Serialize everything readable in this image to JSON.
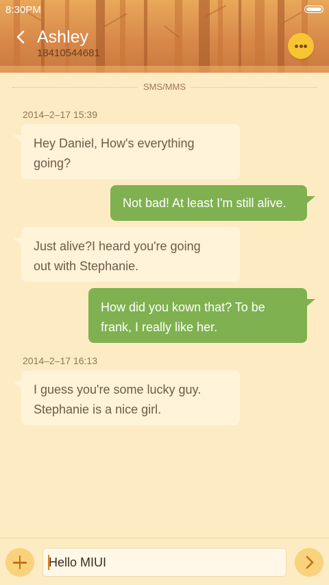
{
  "status_bar": {
    "time": "8:30PM"
  },
  "header": {
    "contact_name": "Ashley",
    "contact_number": "18410544681"
  },
  "icons": {
    "back": "chevron-left-icon",
    "more": "more-dots-icon",
    "add": "plus-icon",
    "send": "chevron-right-icon",
    "battery": "battery-icon"
  },
  "conversation": {
    "channel_label": "SMS/MMS",
    "timestamps": [
      "2014–2–17 15:39",
      "2014–2–17 16:13"
    ],
    "messages": [
      {
        "direction": "incoming",
        "text_lines": [
          "Hey Daniel, How's everything",
          "going?"
        ]
      },
      {
        "direction": "outgoing",
        "text_lines": [
          "Not bad! At least I'm still alive."
        ]
      },
      {
        "direction": "incoming",
        "text_lines": [
          "Just  alive?I heard you're going",
          "out with Stephanie."
        ]
      },
      {
        "direction": "outgoing",
        "text_lines": [
          "How did you kown that? To be",
          "frank, I really like her."
        ]
      },
      {
        "direction": "incoming",
        "text_lines": [
          "I guess you're some lucky guy.",
          "Stephanie is a nice girl."
        ]
      }
    ]
  },
  "composer": {
    "input_value": "Hello MIUI"
  },
  "colors": {
    "background": "#fdebc4",
    "incoming_bubble": "#fff3d9",
    "outgoing_bubble": "#7fb150",
    "accent": "#f7c531"
  }
}
